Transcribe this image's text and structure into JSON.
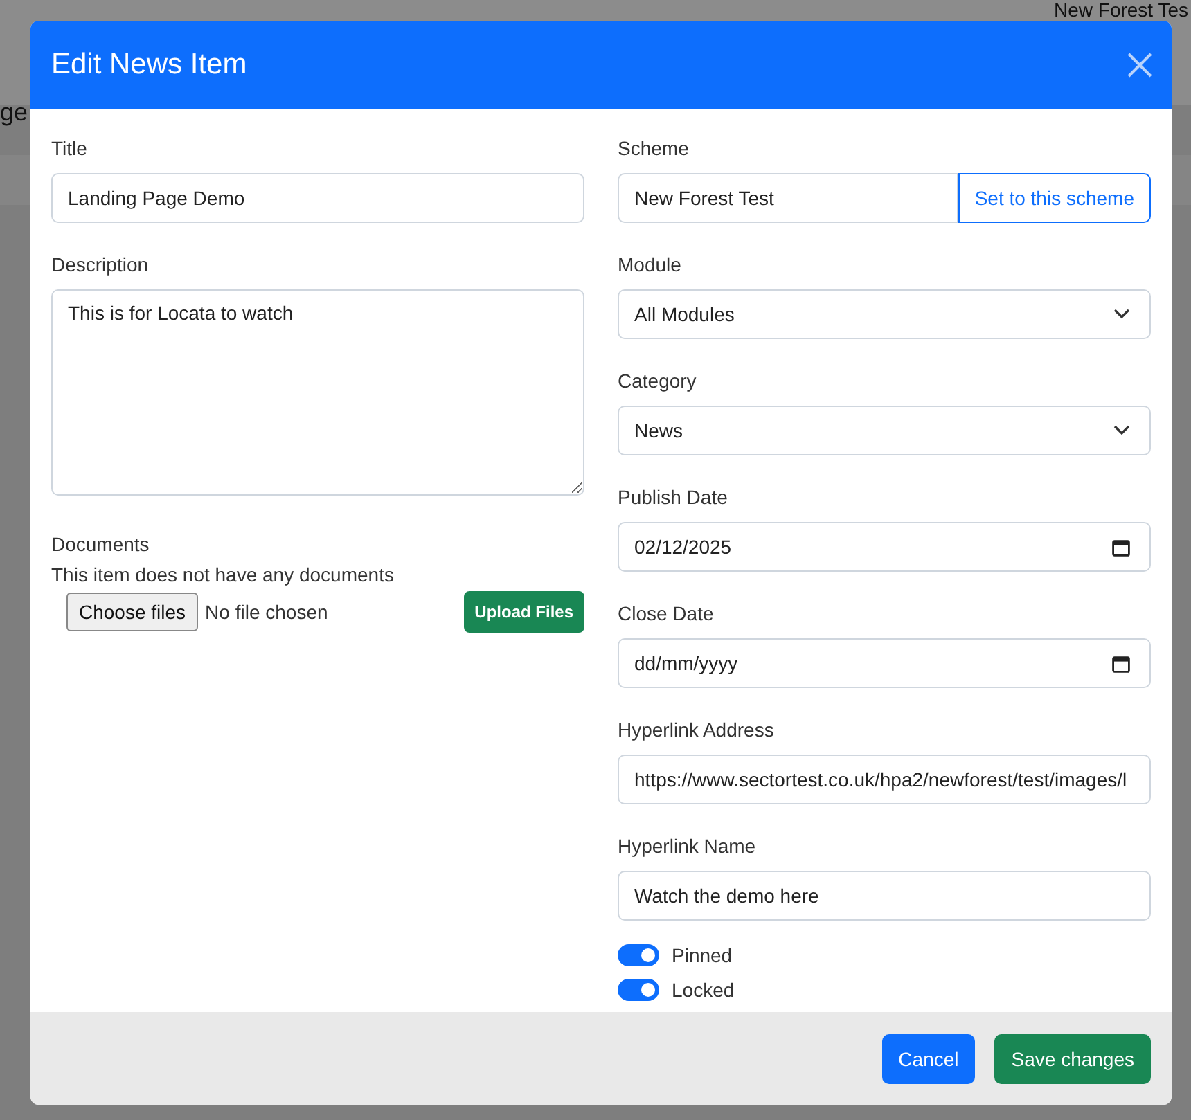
{
  "background": {
    "header_text": "New Forest Tes",
    "page_title_fragment": "ge"
  },
  "dialog": {
    "title": "Edit News Item"
  },
  "left_fields": [
    {
      "kind": "text",
      "label": "Title",
      "value": "Landing Page Demo"
    },
    {
      "kind": "textarea",
      "label": "Description",
      "value": "This is for Locata to watch"
    }
  ],
  "documents": {
    "label": "Documents",
    "note": "This item does not have any documents",
    "choose_button": "Choose files",
    "file_status": "No file chosen",
    "upload_button": "Upload Files"
  },
  "right_fields": [
    {
      "kind": "scheme",
      "label": "Scheme",
      "value": "New Forest Test",
      "button": "Set to this scheme"
    },
    {
      "kind": "select",
      "label": "Module",
      "value": "All Modules"
    },
    {
      "kind": "select",
      "label": "Category",
      "value": "News"
    },
    {
      "kind": "date",
      "label": "Publish Date",
      "value": "02/12/2025"
    },
    {
      "kind": "date",
      "label": "Close Date",
      "placeholder": "dd/mm/yyyy"
    },
    {
      "kind": "text",
      "label": "Hyperlink Address",
      "value": "https://www.sectortest.co.uk/hpa2/newforest/test/images/l"
    },
    {
      "kind": "text",
      "label": "Hyperlink Name",
      "value": "Watch the demo here"
    }
  ],
  "toggles": [
    {
      "label": "Pinned",
      "on": true
    },
    {
      "label": "Locked",
      "on": true
    }
  ],
  "buttons": [
    {
      "kind": "cancel",
      "label": "Cancel"
    },
    {
      "kind": "save",
      "label": "Save changes"
    }
  ]
}
